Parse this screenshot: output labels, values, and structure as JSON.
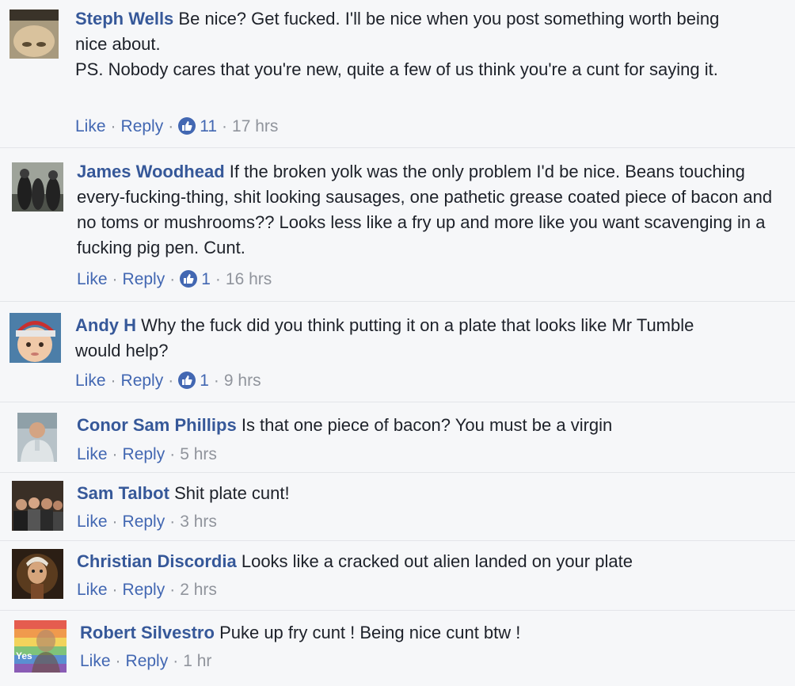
{
  "comments": [
    {
      "author": "Steph Wells",
      "text": "Be nice? Get fucked. I'll be nice when you post something worth being nice about.",
      "text2": "PS. Nobody cares that you're new, quite a few of us think you're a cunt for saying it.",
      "like_label": "Like",
      "reply_label": "Reply",
      "reactions": "11",
      "time": "17 hrs"
    },
    {
      "author": "James Woodhead",
      "text": "If the broken yolk was the only problem I'd be nice. Beans touching every-fucking-thing, shit looking sausages, one pathetic grease coated piece of bacon and no toms or mushrooms?? Looks less like a fry up and more like you want scavenging in a fucking pig pen. Cunt.",
      "like_label": "Like",
      "reply_label": "Reply",
      "reactions": "1",
      "time": "16 hrs"
    },
    {
      "author": "Andy H",
      "text": "Why the fuck did you think putting it on a plate that looks like Mr Tumble would help?",
      "like_label": "Like",
      "reply_label": "Reply",
      "reactions": "1",
      "time": "9 hrs"
    },
    {
      "author": "Conor Sam Phillips",
      "text": "Is that one piece of bacon? You must be a virgin",
      "like_label": "Like",
      "reply_label": "Reply",
      "time": "5 hrs"
    },
    {
      "author": "Sam Talbot",
      "text": "Shit plate cunt!",
      "like_label": "Like",
      "reply_label": "Reply",
      "time": "3 hrs"
    },
    {
      "author": "Christian Discordia",
      "text": "Looks like a cracked out alien landed on your plate",
      "like_label": "Like",
      "reply_label": "Reply",
      "time": "2 hrs"
    },
    {
      "author": "Robert Silvestro",
      "text": "Puke up fry cunt ! Being nice cunt btw !",
      "like_label": "Like",
      "reply_label": "Reply",
      "time": "1 hr",
      "avatar_badge": "Yes"
    }
  ],
  "separator": "·",
  "colors": {
    "link": "#365899",
    "action": "#4267b2",
    "meta": "#90949c",
    "background": "#f6f7f9"
  }
}
